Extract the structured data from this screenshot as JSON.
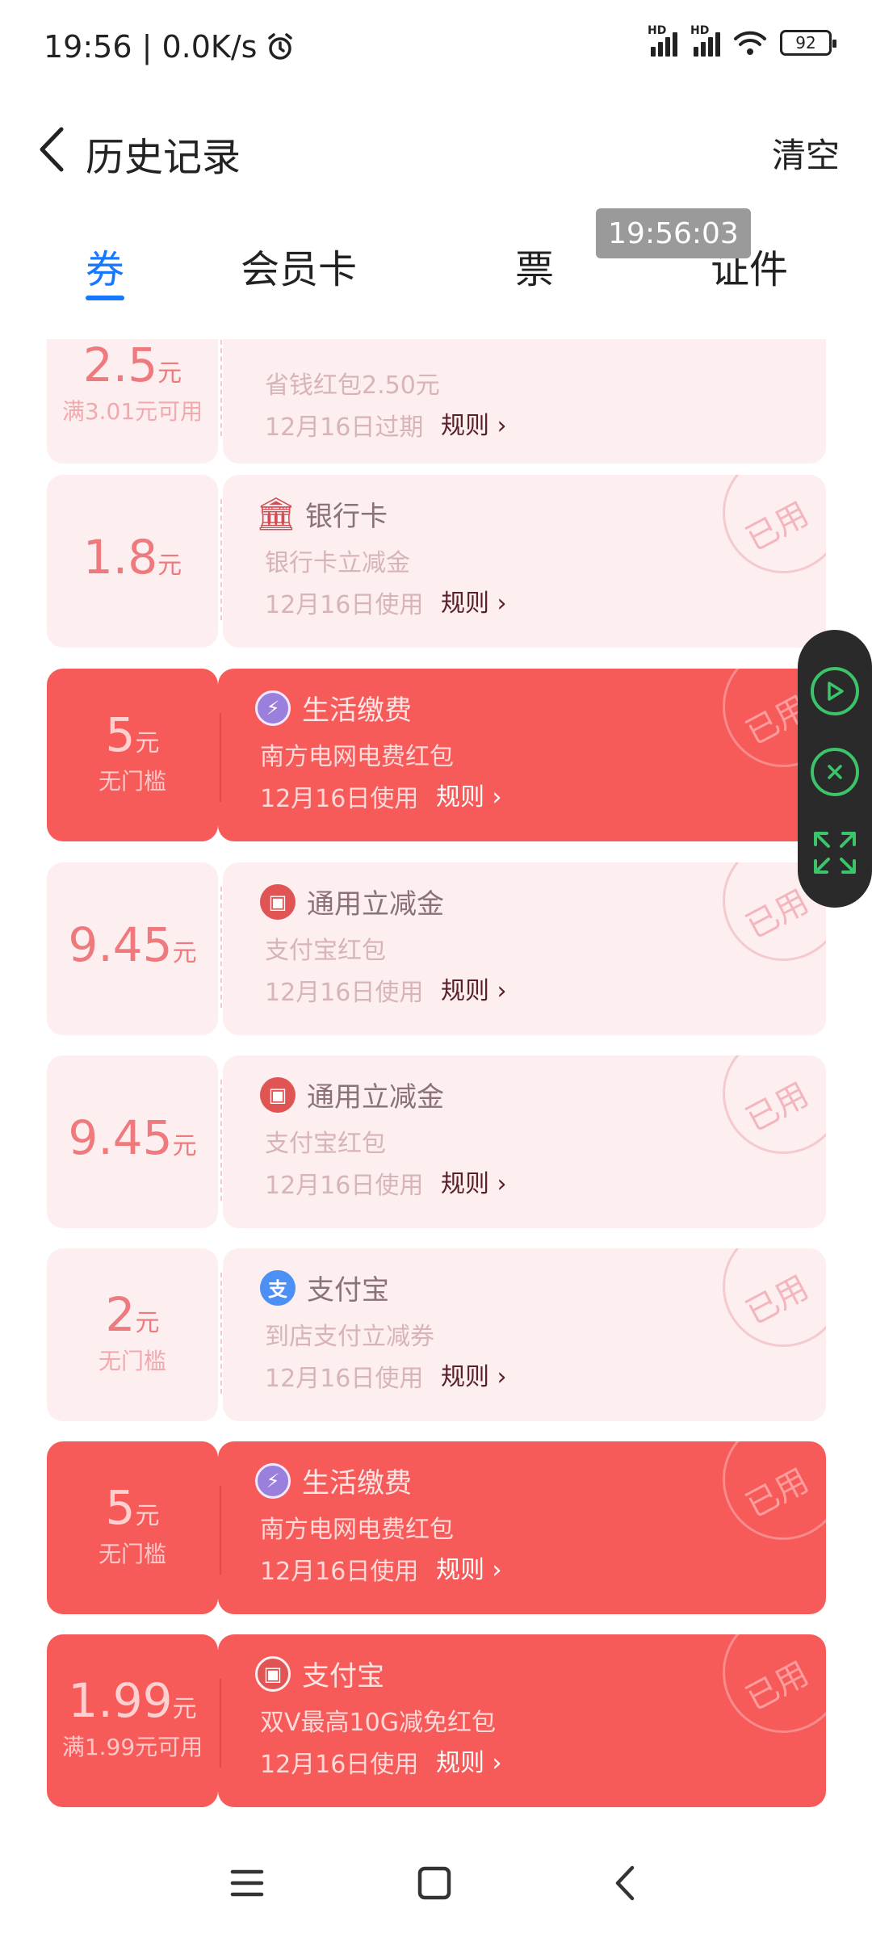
{
  "status": {
    "time_speed": "19:56 | 0.0K/s",
    "battery": "92",
    "hd1": "HD",
    "hd2": "HD"
  },
  "header": {
    "title": "历史记录",
    "clear_label": "清空"
  },
  "tabs": [
    "券",
    "会员卡",
    "票",
    "证件"
  ],
  "time_badge": "19:56:03",
  "cards": [
    {
      "style": "pale",
      "amount": "2.5",
      "unit": "元",
      "condition": "满3.01元可用",
      "category": "",
      "desc": "省钱红包2.50元",
      "date": "12月16日过期",
      "rule": "规则",
      "stamp": ""
    },
    {
      "style": "pale",
      "amount": "1.8",
      "unit": "元",
      "condition": "",
      "category": "银行卡",
      "desc": "银行卡立减金",
      "date": "12月16日使用",
      "rule": "规则",
      "stamp": "已用"
    },
    {
      "style": "red",
      "amount": "5",
      "unit": "元",
      "condition": "无门槛",
      "category": "生活缴费",
      "desc": "南方电网电费红包",
      "date": "12月16日使用",
      "rule": "规则",
      "stamp": "已用"
    },
    {
      "style": "pale",
      "amount": "9.45",
      "unit": "元",
      "condition": "",
      "category": "通用立减金",
      "desc": "支付宝红包",
      "date": "12月16日使用",
      "rule": "规则",
      "stamp": "已用"
    },
    {
      "style": "pale",
      "amount": "9.45",
      "unit": "元",
      "condition": "",
      "category": "通用立减金",
      "desc": "支付宝红包",
      "date": "12月16日使用",
      "rule": "规则",
      "stamp": "已用"
    },
    {
      "style": "pale",
      "amount": "2",
      "unit": "元",
      "condition": "无门槛",
      "category": "支付宝",
      "desc": "到店支付立减券",
      "date": "12月16日使用",
      "rule": "规则",
      "stamp": "已用"
    },
    {
      "style": "red",
      "amount": "5",
      "unit": "元",
      "condition": "无门槛",
      "category": "生活缴费",
      "desc": "南方电网电费红包",
      "date": "12月16日使用",
      "rule": "规则",
      "stamp": "已用"
    },
    {
      "style": "red",
      "amount": "1.99",
      "unit": "元",
      "condition": "满1.99元可用",
      "category": "支付宝",
      "desc": "双V最高10G减免红包",
      "date": "12月16日使用",
      "rule": "规则",
      "stamp": "已用"
    }
  ]
}
